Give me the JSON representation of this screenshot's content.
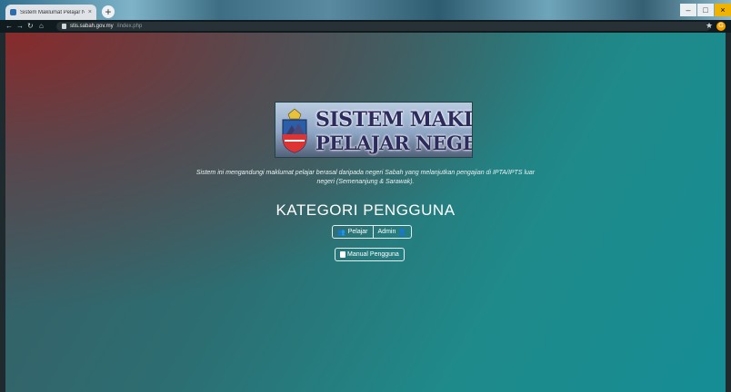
{
  "browser": {
    "tab_title": "Sistem Maklumat Pelajar Negeri",
    "tab_close": "×",
    "new_tab": "+",
    "url_host": "stis.sabah.gov.my",
    "url_path": "/index.php",
    "profile_initial": "G",
    "window_controls": [
      "–",
      "□",
      "×"
    ]
  },
  "banner": {
    "line1": "SISTEM MAKLUMAT",
    "line2": "PELAJAR NEGERI SABAH"
  },
  "description": "Sistem ini mengandungi maklumat pelajar berasal daripada negeri Sabah yang melanjutkan pengajian di IPTA/IPTS luar negeri (Semenanjung & Sarawak).",
  "heading": "KATEGORI PENGGUNA",
  "buttons": {
    "pelajar": "Pelajar",
    "admin": "Admin",
    "manual": "Manual Pengguna"
  },
  "colors": {
    "accent_top_left": "#8c2828",
    "background_teal": "#158d95"
  }
}
